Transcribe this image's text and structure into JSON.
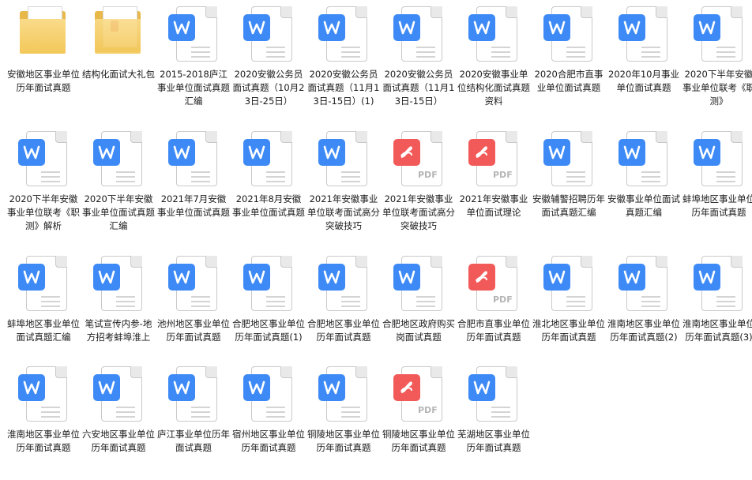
{
  "files": [
    {
      "type": "folder",
      "label": "安徽地区事业单位历年面试真题"
    },
    {
      "type": "folder-pdf",
      "label": "结构化面试大礼包"
    },
    {
      "type": "word",
      "label": "2015-2018庐江事业单位面试真题汇编"
    },
    {
      "type": "word",
      "label": "2020安徽公务员面试真题（10月23日-25日）"
    },
    {
      "type": "word",
      "label": "2020安徽公务员面试真题（11月13日-15日）(1)"
    },
    {
      "type": "word",
      "label": "2020安徽公务员面试真题（11月13日-15日）"
    },
    {
      "type": "word",
      "label": "2020安徽事业单位结构化面试真题资料"
    },
    {
      "type": "word",
      "label": "2020合肥市直事业单位面试真题"
    },
    {
      "type": "word",
      "label": "2020年10月事业单位面试真题"
    },
    {
      "type": "word",
      "label": "2020下半年安徽事业单位联考《职测》"
    },
    {
      "type": "word",
      "label": "2020下半年安徽事业单位联考《职测》解析"
    },
    {
      "type": "word",
      "label": "2020下半年安徽事业单位面试真题汇编"
    },
    {
      "type": "word",
      "label": "2021年7月安徽事业单位面试真题"
    },
    {
      "type": "word",
      "label": "2021年8月安徽事业单位面试真题"
    },
    {
      "type": "word",
      "label": "2021年安徽事业单位联考面试高分突破技巧"
    },
    {
      "type": "pdf",
      "label": "2021年安徽事业单位联考面试高分突破技巧"
    },
    {
      "type": "pdf",
      "label": "2021年安徽事业单位面试理论"
    },
    {
      "type": "word",
      "label": "安徽辅警招聘历年面试真题汇编"
    },
    {
      "type": "word",
      "label": "安徽事业单位面试真题汇编"
    },
    {
      "type": "word",
      "label": "蚌埠地区事业单位历年面试真题"
    },
    {
      "type": "word",
      "label": "蚌埠地区事业单位面试真题汇编"
    },
    {
      "type": "word",
      "label": "笔试宣传内参-地方招考蚌埠淮上"
    },
    {
      "type": "word",
      "label": "池州地区事业单位历年面试真题"
    },
    {
      "type": "word",
      "label": "合肥地区事业单位历年面试真题(1)"
    },
    {
      "type": "word",
      "label": "合肥地区事业单位历年面试真题"
    },
    {
      "type": "word",
      "label": "合肥地区政府购买岗面试真题"
    },
    {
      "type": "pdf",
      "label": "合肥市直事业单位历年面试真题"
    },
    {
      "type": "word",
      "label": "淮北地区事业单位历年面试真题"
    },
    {
      "type": "word",
      "label": "淮南地区事业单位历年面试真题(2)"
    },
    {
      "type": "word",
      "label": "淮南地区事业单位历年面试真题(3)"
    },
    {
      "type": "word",
      "label": "淮南地区事业单位历年面试真题"
    },
    {
      "type": "word",
      "label": "六安地区事业单位历年面试真题"
    },
    {
      "type": "word",
      "label": "庐江事业单位历年面试真题"
    },
    {
      "type": "word",
      "label": "宿州地区事业单位历年面试真题"
    },
    {
      "type": "word",
      "label": "铜陵地区事业单位历年面试真题"
    },
    {
      "type": "pdf",
      "label": "铜陵地区事业单位历年面试真题"
    },
    {
      "type": "word",
      "label": "芜湖地区事业单位历年面试真题"
    }
  ],
  "icons": {
    "word_color": "#3d8af7",
    "pdf_color": "#f25a5a",
    "pdf_text": "PDF"
  }
}
